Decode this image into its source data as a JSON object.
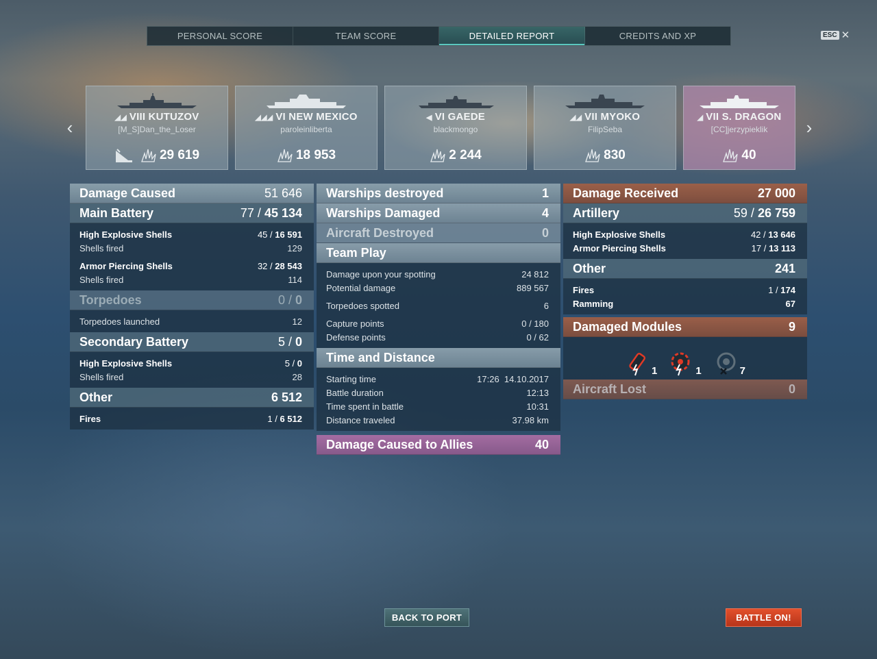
{
  "tabs": [
    {
      "label": "PERSONAL SCORE",
      "active": false
    },
    {
      "label": "TEAM SCORE",
      "active": false
    },
    {
      "label": "DETAILED REPORT",
      "active": true
    },
    {
      "label": "CREDITS AND XP",
      "active": false
    }
  ],
  "esc": {
    "key": "ESC",
    "close_icon": "close-icon"
  },
  "ships": [
    {
      "tier_name": "VIII KUTUZOV",
      "player": "[M_S]Dan_the_Loser",
      "score": "29 619",
      "class_icon": "cruiser-icon",
      "destroyed": true,
      "highlight": false
    },
    {
      "tier_name": "VI NEW MEXICO",
      "player": "paroleinliberta",
      "score": "18 953",
      "class_icon": "battleship-icon",
      "destroyed": false,
      "highlight": false
    },
    {
      "tier_name": "VI GAEDE",
      "player": "blackmongo",
      "score": "2 244",
      "class_icon": "destroyer-icon",
      "destroyed": false,
      "highlight": false
    },
    {
      "tier_name": "VII MYOKO",
      "player": "FilipSeba",
      "score": "830",
      "class_icon": "cruiser-icon",
      "destroyed": false,
      "highlight": false
    },
    {
      "tier_name": "VII S. DRAGON",
      "player": "[CC]jerzypieklik",
      "score": "40",
      "class_icon": "cruiser-icon",
      "destroyed": false,
      "highlight": true
    }
  ],
  "left": {
    "damage_caused": {
      "label": "Damage Caused",
      "value": "51 646"
    },
    "main_battery": {
      "label": "Main Battery",
      "hits": "77 / ",
      "dmg": "45 134"
    },
    "he": {
      "label": "High Explosive Shells",
      "hits": "45 / ",
      "dmg": "16 591"
    },
    "he_fired": {
      "label": "Shells fired",
      "value": "129"
    },
    "ap": {
      "label": "Armor Piercing Shells",
      "hits": "32 / ",
      "dmg": "28 543"
    },
    "ap_fired": {
      "label": "Shells fired",
      "value": "114"
    },
    "torpedoes": {
      "label": "Torpedoes",
      "hits": "0 / ",
      "dmg": "0"
    },
    "torp_launched": {
      "label": "Torpedoes launched",
      "value": "12"
    },
    "secondary": {
      "label": "Secondary Battery",
      "hits": "5 / ",
      "dmg": "0"
    },
    "sec_he": {
      "label": "High Explosive Shells",
      "hits": "5 / ",
      "dmg": "0"
    },
    "sec_fired": {
      "label": "Shells fired",
      "value": "28"
    },
    "other": {
      "label": "Other",
      "value": "6 512"
    },
    "fires": {
      "label": "Fires",
      "hits": "1 / ",
      "dmg": "6 512"
    }
  },
  "mid": {
    "destroyed": {
      "label": "Warships destroyed",
      "value": "1"
    },
    "damaged": {
      "label": "Warships Damaged",
      "value": "4"
    },
    "aircraft": {
      "label": "Aircraft Destroyed",
      "value": "0"
    },
    "team_play": {
      "label": "Team Play"
    },
    "spotting": {
      "label": "Damage upon your spotting",
      "value": "24 812"
    },
    "potential": {
      "label": "Potential damage",
      "value": "889 567"
    },
    "torp_spotted": {
      "label": "Torpedoes spotted",
      "value": "6"
    },
    "capture": {
      "label": "Capture points",
      "value": "0 / 180"
    },
    "defense": {
      "label": "Defense points",
      "value": "0 / 62"
    },
    "time_dist": {
      "label": "Time and Distance"
    },
    "start": {
      "label": "Starting time",
      "value": "17:26  14.10.2017"
    },
    "duration": {
      "label": "Battle duration",
      "value": "12:13"
    },
    "spent": {
      "label": "Time spent in battle",
      "value": "10:31"
    },
    "distance": {
      "label": "Distance traveled",
      "value": "37.98 km"
    },
    "allies": {
      "label": "Damage Caused to Allies",
      "value": "40"
    }
  },
  "right": {
    "received": {
      "label": "Damage Received",
      "value": "27 000"
    },
    "artillery": {
      "label": "Artillery",
      "hits": "59 / ",
      "dmg": "26 759"
    },
    "he": {
      "label": "High Explosive Shells",
      "hits": "42 / ",
      "dmg": "13 646"
    },
    "ap": {
      "label": "Armor Piercing Shells",
      "hits": "17 / ",
      "dmg": "13 113"
    },
    "other": {
      "label": "Other",
      "value": "241"
    },
    "fires": {
      "label": "Fires",
      "hits": "1 / ",
      "dmg": "174"
    },
    "ramming": {
      "label": "Ramming",
      "value": "67"
    },
    "modules": {
      "label": "Damaged Modules",
      "value": "9"
    },
    "module_items": [
      {
        "icon": "main-battery-damaged-icon",
        "count": "1"
      },
      {
        "icon": "engine-damaged-icon",
        "count": "1"
      },
      {
        "icon": "aa-guns-destroyed-icon",
        "count": "7"
      }
    ],
    "aircraft_lost": {
      "label": "Aircraft Lost",
      "value": "0"
    }
  },
  "buttons": {
    "back": "BACK TO PORT",
    "battle": "BATTLE ON!"
  },
  "colors": {
    "accent_teal": "#5bc8c0",
    "battle_orange": "#d64424",
    "received_brown": "#9a5c44",
    "allies_pink": "#a86aa4"
  }
}
